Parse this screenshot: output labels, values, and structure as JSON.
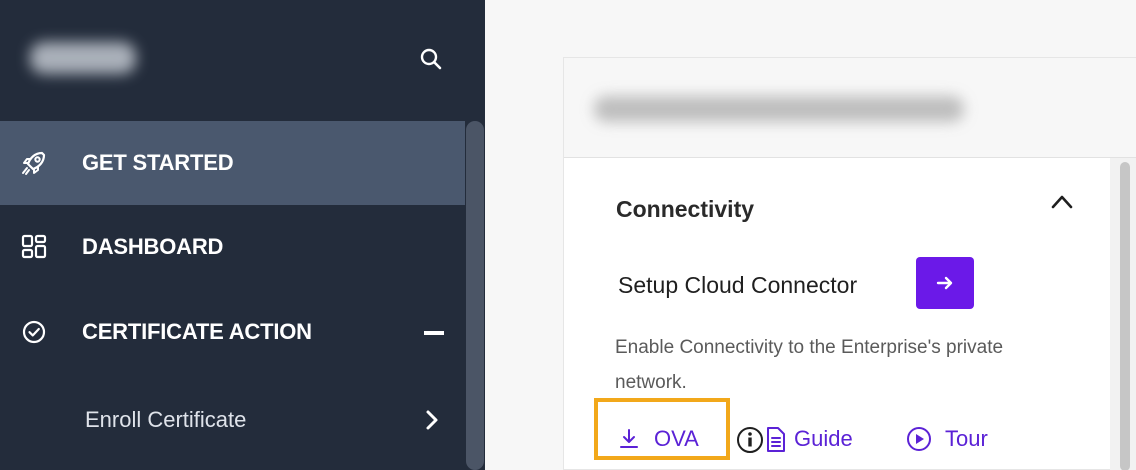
{
  "sidebar": {
    "logo_text": "",
    "search_icon": "search-icon",
    "items": [
      {
        "label": "GET STARTED",
        "icon": "rocket-icon",
        "active": true
      },
      {
        "label": "DASHBOARD",
        "icon": "dashboard-grid-icon",
        "active": false
      },
      {
        "label": "CERTIFICATE ACTION",
        "icon": "check-circle-icon",
        "active": false,
        "expanded": true
      }
    ],
    "sub_items": [
      {
        "label": "Enroll Certificate",
        "icon": "chevron-right-icon"
      }
    ]
  },
  "main": {
    "page_title": "",
    "section": {
      "title": "Connectivity",
      "expanded": true,
      "task_label": "Setup Cloud Connector",
      "description": "Enable Connectivity to the Enterprise's private network.",
      "links": [
        {
          "label": "OVA",
          "icon": "download-icon",
          "highlighted": true
        },
        {
          "label": "Guide",
          "icon": "info-document-icon"
        },
        {
          "label": "Tour",
          "icon": "play-circle-icon"
        }
      ]
    }
  },
  "colors": {
    "sidebar_bg": "#232c3b",
    "sidebar_active": "#4a586e",
    "accent": "#6b19e8",
    "link": "#5b22d6",
    "highlight": "#f2a81a"
  }
}
